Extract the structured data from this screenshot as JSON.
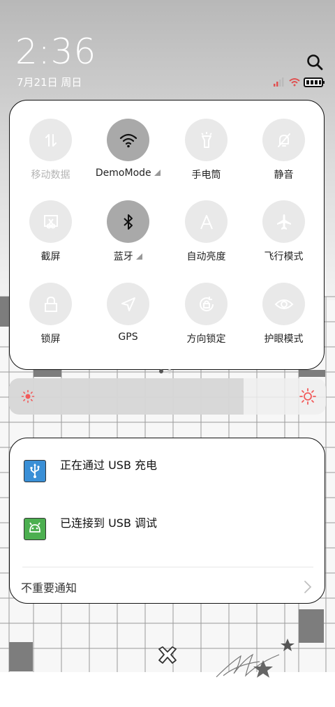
{
  "status": {
    "time": "2:36",
    "date": "7月21日 周日"
  },
  "quick_settings": {
    "tiles": [
      {
        "label": "移动数据",
        "icon": "mobile-data-icon",
        "state": "disabled"
      },
      {
        "label": "DemoMode",
        "icon": "wifi-icon",
        "state": "on",
        "expandable": true
      },
      {
        "label": "手电筒",
        "icon": "flashlight-icon",
        "state": "off"
      },
      {
        "label": "静音",
        "icon": "mute-bell-icon",
        "state": "off"
      },
      {
        "label": "截屏",
        "icon": "screenshot-icon",
        "state": "off"
      },
      {
        "label": "蓝牙",
        "icon": "bluetooth-icon",
        "state": "on",
        "expandable": true
      },
      {
        "label": "自动亮度",
        "icon": "auto-brightness-icon",
        "state": "off"
      },
      {
        "label": "飞行模式",
        "icon": "airplane-icon",
        "state": "off"
      },
      {
        "label": "锁屏",
        "icon": "lock-icon",
        "state": "off"
      },
      {
        "label": "GPS",
        "icon": "gps-icon",
        "state": "off"
      },
      {
        "label": "方向锁定",
        "icon": "rotation-lock-icon",
        "state": "off"
      },
      {
        "label": "护眼模式",
        "icon": "eye-icon",
        "state": "off"
      }
    ],
    "page_count": 2,
    "current_page": 1
  },
  "brightness": {
    "level": 0.74,
    "accent": "#f25a5a"
  },
  "notifications": {
    "items": [
      {
        "text": "正在通过 USB 充电",
        "icon": "usb-icon",
        "icon_color": "#3a8fd6"
      },
      {
        "text": "已连接到 USB 调试",
        "icon": "android-debug-icon",
        "icon_color": "#4caf50"
      }
    ],
    "minor_label": "不重要通知"
  }
}
